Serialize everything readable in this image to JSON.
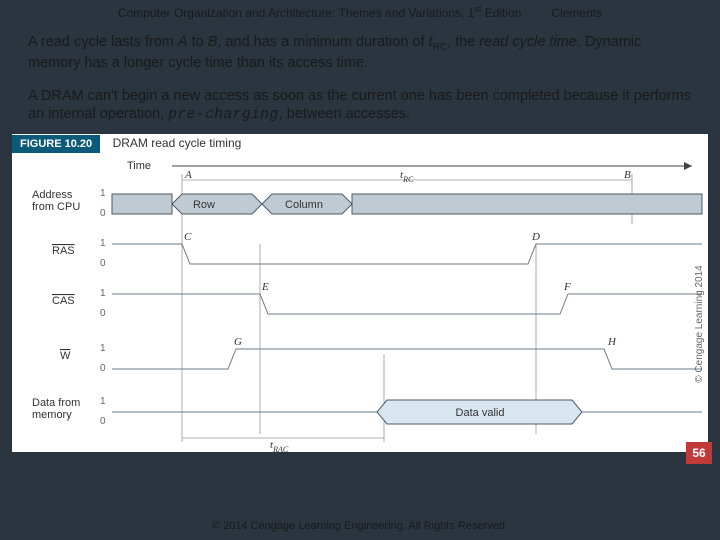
{
  "header": {
    "title_left": "Computer Organization and Architecture: Themes and Variations, 1",
    "title_sup": "st",
    "title_after": " Edition",
    "author": "Clements"
  },
  "p1": {
    "t1": "A read cycle lasts from ",
    "A": "A",
    "t2": " to ",
    "B": "B",
    "t3": ", and has a minimum duration of ",
    "tRC_t": "t",
    "tRC_sub": "RC",
    "t4": ", the ",
    "rct": "read cycle time",
    "t5": ". Dynamic memory has a longer cycle time than its access time."
  },
  "p2": {
    "t1": "A DRAM can't begin a new access as soon as the current one has been completed because it performs an internal operation, ",
    "pre": "pre-charging",
    "t2": ", between accesses."
  },
  "figure": {
    "label": "FIGURE 10.20",
    "caption": "DRAM read cycle timing",
    "time_arrow": "Time",
    "rows": {
      "addr_l1": "Address",
      "addr_l2": "from CPU",
      "ras": "RAS",
      "cas": "CAS",
      "w": "W",
      "data_l1": "Data from",
      "data_l2": "memory"
    },
    "levels_hi": "1",
    "levels_lo": "0",
    "bus_row": "Row",
    "bus_col": "Column",
    "data_valid": "Data valid",
    "trc": "t",
    "trc_sub": "RC",
    "trac": "t",
    "trac_sub": "RAC",
    "pts": {
      "A": "A",
      "B": "B",
      "C": "C",
      "D": "D",
      "E": "E",
      "F": "F",
      "G": "G",
      "H": "H"
    },
    "copyright_side": "© Cengage Learning 2014"
  },
  "page_number": "56",
  "footer": "© 2014 Cengage Learning Engineering. All Rights Reserved."
}
